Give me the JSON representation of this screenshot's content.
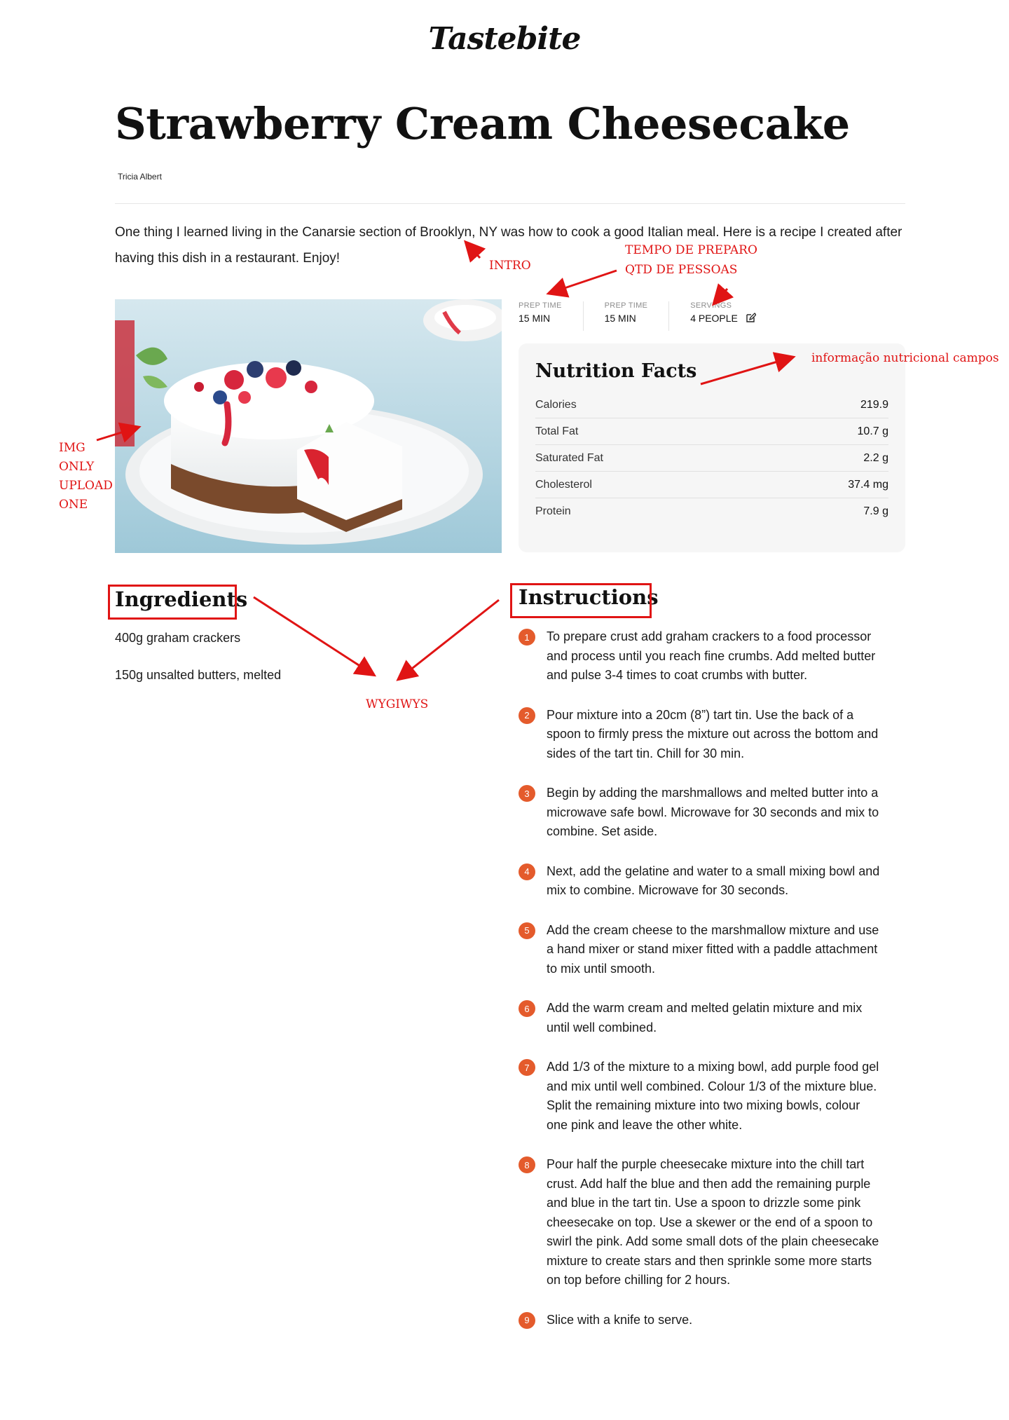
{
  "brand": {
    "logo_text": "Tastebite"
  },
  "recipe": {
    "title": "Strawberry Cream Cheesecake",
    "author": "Tricia Albert",
    "intro": "One thing I learned living in the Canarsie section of Brooklyn, NY was how to cook a good Italian meal. Here is a recipe I created after having this dish in a restaurant. Enjoy!",
    "image_alt": "Strawberry cream cheesecake topped with berries",
    "stats": [
      {
        "label": "PREP TIME",
        "value": "15 MIN"
      },
      {
        "label": "PREP TIME",
        "value": "15 MIN"
      },
      {
        "label": "SERVINGS",
        "value": "4 PEOPLE",
        "icon": "edit-icon"
      }
    ],
    "nutrition": {
      "title": "Nutrition Facts",
      "rows": [
        {
          "name": "Calories",
          "value": "219.9"
        },
        {
          "name": "Total Fat",
          "value": "10.7 g"
        },
        {
          "name": "Saturated Fat",
          "value": "2.2 g"
        },
        {
          "name": "Cholesterol",
          "value": "37.4 mg"
        },
        {
          "name": "Protein",
          "value": "7.9 g"
        }
      ]
    },
    "ingredients": {
      "title": "Ingredients",
      "items": [
        "400g graham crackers",
        "150g unsalted butters, melted"
      ]
    },
    "instructions": {
      "title": "Instructions",
      "steps": [
        {
          "n": "1",
          "text": "To prepare crust add graham crackers to a food processor and process until you reach fine crumbs. Add melted butter and pulse 3-4 times to coat crumbs with butter."
        },
        {
          "n": "2",
          "text": "Pour mixture into a 20cm (8”) tart tin. Use the back of a spoon to firmly press the mixture out across the bottom and sides of the tart tin. Chill for 30 min."
        },
        {
          "n": "3",
          "text": "Begin by adding the marshmallows and melted butter into a microwave safe bowl. Microwave for 30 seconds and mix to combine. Set aside."
        },
        {
          "n": "4",
          "text": "Next, add the gelatine and water to a small mixing bowl and mix to combine. Microwave for 30 seconds."
        },
        {
          "n": "5",
          "text": "Add the cream cheese to the marshmallow mixture and use a hand mixer or stand mixer fitted with a paddle attachment to mix until smooth."
        },
        {
          "n": "6",
          "text": "Add the warm cream and melted gelatin mixture and mix until well combined."
        },
        {
          "n": "7",
          "text": "Add 1/3 of the mixture to a mixing bowl, add purple food gel and mix until well combined. Colour 1/3 of the mixture blue. Split the remaining mixture into two mixing bowls, colour one pink and leave the other white."
        },
        {
          "n": "8",
          "text": "Pour half the purple cheesecake mixture into the chill tart crust. Add half the blue and then add the remaining purple and blue in the tart tin. Use a spoon to drizzle some pink cheesecake on top. Use a skewer or the end of a spoon to swirl the pink. Add some small dots of the plain cheesecake mixture to create stars and then sprinkle some more starts on top before chilling for 2 hours."
        },
        {
          "n": "9",
          "text": "Slice with a knife to serve."
        }
      ]
    }
  },
  "annotations": {
    "intro": "INTRO",
    "prep_line1": "TEMPO DE PREPARO",
    "prep_line2": "QTD DE PESSOAS",
    "nutrition": "informação nutricional campos",
    "img_lines": [
      "IMG",
      "ONLY",
      "UPLOAD",
      "ONE"
    ],
    "editor": "WYGIWYS",
    "color": "#e01414"
  },
  "colors": {
    "accent": "#e45b2c",
    "panel": "#f6f6f6",
    "text": "#111111"
  }
}
